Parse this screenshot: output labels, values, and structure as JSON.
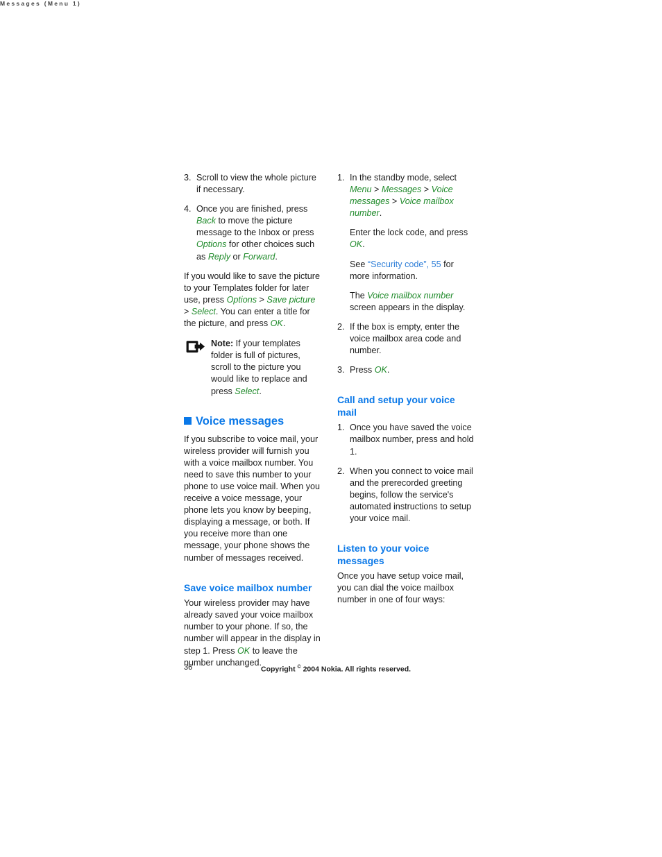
{
  "header": {
    "running_head": "Messages (Menu 1)"
  },
  "left_column": {
    "steps": [
      {
        "num": "3.",
        "text_parts": [
          {
            "t": "Scroll to view the whole picture if necessary.",
            "s": "plain"
          }
        ]
      },
      {
        "num": "4.",
        "text_parts": [
          {
            "t": "Once you are finished, press ",
            "s": "plain"
          },
          {
            "t": "Back",
            "s": "ui"
          },
          {
            "t": " to move the picture message to the Inbox or press ",
            "s": "plain"
          },
          {
            "t": "Options",
            "s": "ui"
          },
          {
            "t": " for other choices such as ",
            "s": "plain"
          },
          {
            "t": "Reply",
            "s": "ui"
          },
          {
            "t": " or ",
            "s": "plain"
          },
          {
            "t": "Forward",
            "s": "ui"
          },
          {
            "t": ".",
            "s": "plain"
          }
        ]
      }
    ],
    "paragraph_templates": [
      {
        "t": "If you would like to save the picture to your Templates folder for later use, press ",
        "s": "plain"
      },
      {
        "t": "Options",
        "s": "ui"
      },
      {
        "t": " > ",
        "s": "plain"
      },
      {
        "t": "Save picture",
        "s": "ui"
      },
      {
        "t": " > ",
        "s": "plain"
      },
      {
        "t": "Select",
        "s": "ui"
      },
      {
        "t": ". You can enter a title for the picture, and press ",
        "s": "plain"
      },
      {
        "t": "OK",
        "s": "ui"
      },
      {
        "t": ".",
        "s": "plain"
      }
    ],
    "note": {
      "icon_name": "note-pointer-icon",
      "label": "Note:",
      "parts": [
        {
          "t": " If your templates folder is full of pictures, scroll to the picture you would like to replace and press ",
          "s": "plain"
        },
        {
          "t": "Select",
          "s": "ui"
        },
        {
          "t": ".",
          "s": "plain"
        }
      ]
    },
    "section_heading": "Voice messages",
    "section_body": "If you subscribe to voice mail, your wireless provider will furnish you with a voice mailbox number. You need to save this number to your phone to use voice mail. When you receive a voice message, your phone lets you know by beeping, displaying a message, or both. If you receive more than one message, your phone shows the number of messages received.",
    "sub_heading": "Save voice mailbox number",
    "sub_body_parts": [
      {
        "t": "Your wireless provider may have already saved your voice mailbox number to your phone. If so, the number will appear in the display in step 1. Press ",
        "s": "plain"
      },
      {
        "t": "OK",
        "s": "ui"
      },
      {
        "t": " to leave the number unchanged.",
        "s": "plain"
      }
    ]
  },
  "right_column": {
    "steps": [
      {
        "num": "1.",
        "paragraphs": [
          [
            {
              "t": "In the standby mode, select ",
              "s": "plain"
            },
            {
              "t": "Menu",
              "s": "ui"
            },
            {
              "t": " > ",
              "s": "plain"
            },
            {
              "t": "Messages",
              "s": "ui"
            },
            {
              "t": " > ",
              "s": "plain"
            },
            {
              "t": "Voice messages",
              "s": "ui"
            },
            {
              "t": " > ",
              "s": "plain"
            },
            {
              "t": "Voice mailbox number",
              "s": "ui"
            },
            {
              "t": ".",
              "s": "plain"
            }
          ],
          [
            {
              "t": "Enter the lock code, and press ",
              "s": "plain"
            },
            {
              "t": "OK",
              "s": "ui"
            },
            {
              "t": ".",
              "s": "plain"
            }
          ],
          [
            {
              "t": "See ",
              "s": "plain"
            },
            {
              "t": "“Security code”, 55",
              "s": "link"
            },
            {
              "t": " for more information.",
              "s": "plain"
            }
          ],
          [
            {
              "t": "The ",
              "s": "plain"
            },
            {
              "t": "Voice mailbox number",
              "s": "ui"
            },
            {
              "t": " screen appears in the display.",
              "s": "plain"
            }
          ]
        ]
      },
      {
        "num": "2.",
        "paragraphs": [
          [
            {
              "t": "If the box is empty, enter the voice mailbox area code and number.",
              "s": "plain"
            }
          ]
        ]
      },
      {
        "num": "3.",
        "paragraphs": [
          [
            {
              "t": "Press ",
              "s": "plain"
            },
            {
              "t": "OK",
              "s": "ui"
            },
            {
              "t": ".",
              "s": "plain"
            }
          ]
        ]
      }
    ],
    "heading_1": "Call and setup your voice mail",
    "steps_2": [
      {
        "num": "1.",
        "paragraphs": [
          [
            {
              "t": "Once you have saved the voice mailbox number, press and hold 1.",
              "s": "plain"
            }
          ]
        ]
      },
      {
        "num": "2.",
        "paragraphs": [
          [
            {
              "t": "When you connect to voice mail and the prerecorded greeting begins, follow the service's automated instructions to setup your voice mail.",
              "s": "plain"
            }
          ]
        ]
      }
    ],
    "heading_2": "Listen to your voice messages",
    "body_2": "Once you have setup voice mail, you can dial the voice mailbox number in one of four ways:"
  },
  "footer": {
    "page_number": "36",
    "copyright_before": "Copyright ",
    "copyright_symbol": "©",
    "copyright_after": " 2004 Nokia. All rights reserved."
  },
  "colors": {
    "heading_blue": "#0a78e8",
    "ui_green": "#1f8a2a",
    "link_blue": "#2f7fd8",
    "body_text": "#1c1c1c",
    "running_head": "#3d3d3d"
  }
}
